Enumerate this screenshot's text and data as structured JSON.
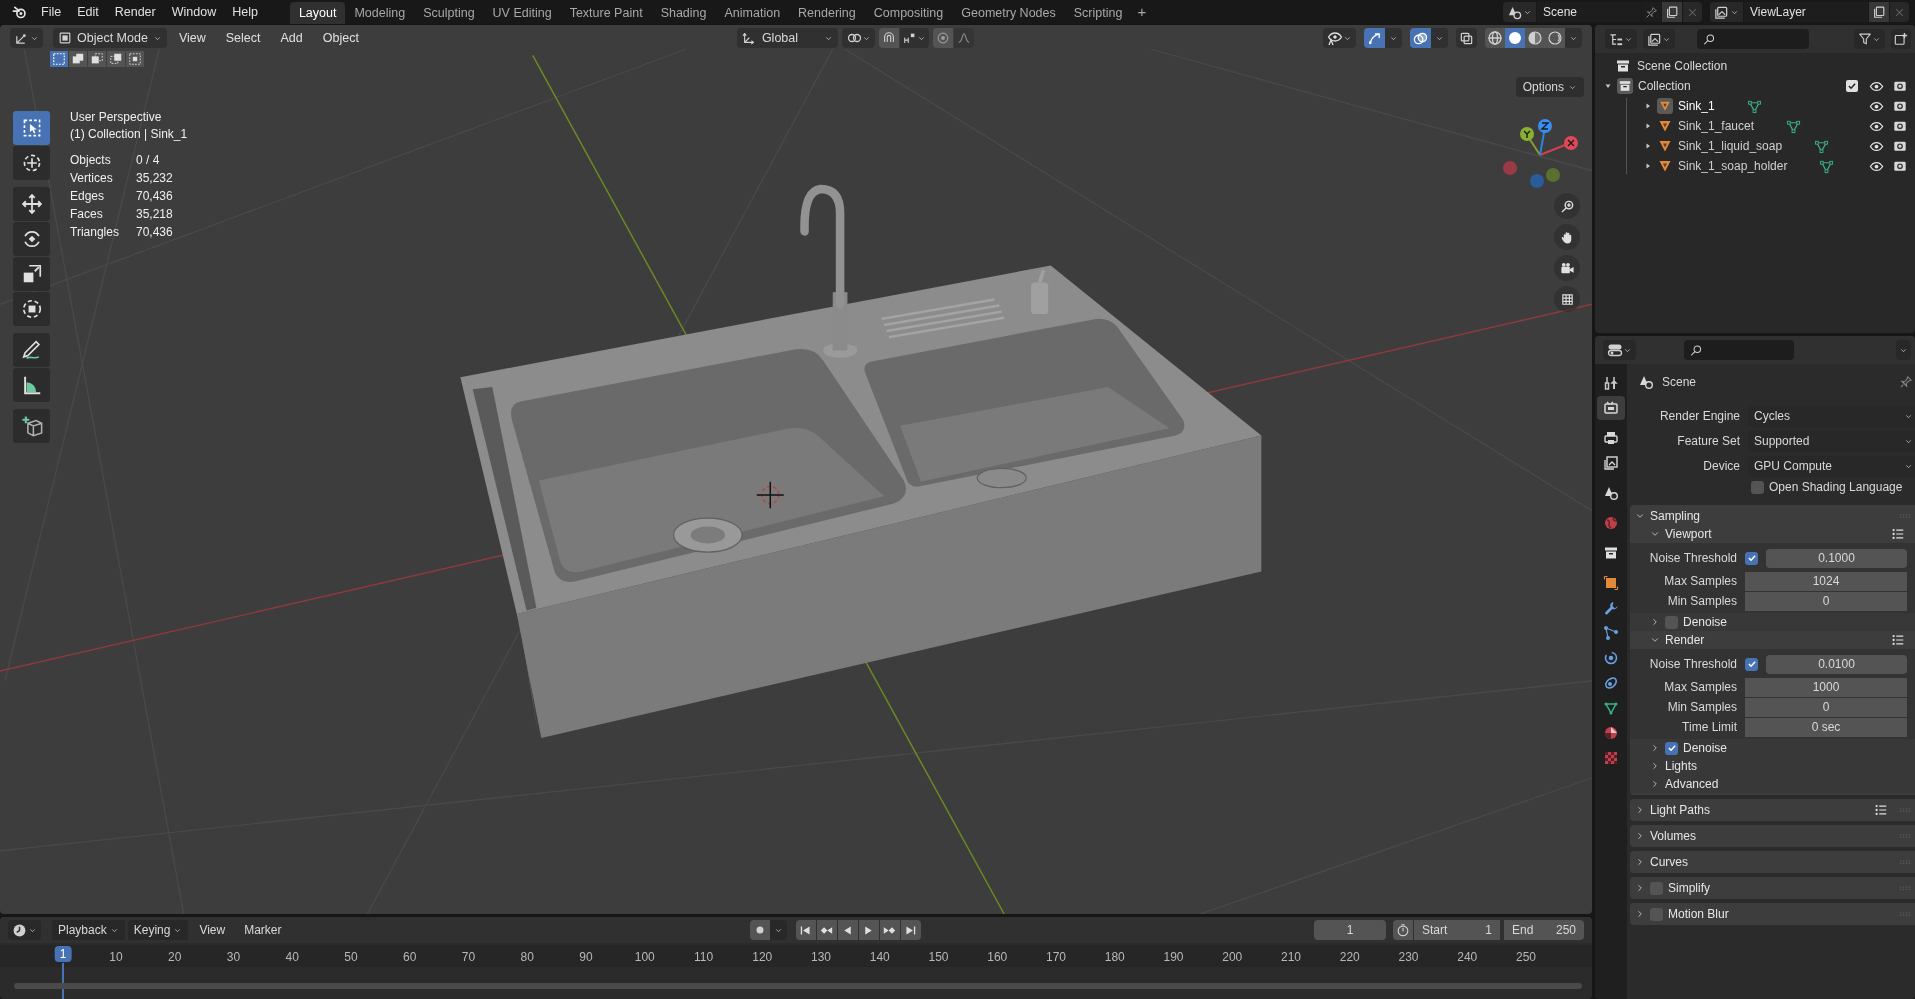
{
  "top_menu": [
    "File",
    "Edit",
    "Render",
    "Window",
    "Help"
  ],
  "workspaces": [
    {
      "label": "Layout",
      "selected": true
    },
    {
      "label": "Modeling",
      "selected": false
    },
    {
      "label": "Sculpting",
      "selected": false
    },
    {
      "label": "UV Editing",
      "selected": false
    },
    {
      "label": "Texture Paint",
      "selected": false
    },
    {
      "label": "Shading",
      "selected": false
    },
    {
      "label": "Animation",
      "selected": false
    },
    {
      "label": "Rendering",
      "selected": false
    },
    {
      "label": "Compositing",
      "selected": false
    },
    {
      "label": "Geometry Nodes",
      "selected": false
    },
    {
      "label": "Scripting",
      "selected": false
    }
  ],
  "add_workspace": "+",
  "scene": "Scene",
  "view_layer": "ViewLayer",
  "viewport": {
    "mode": "Object Mode",
    "menus": [
      "View",
      "Select",
      "Add",
      "Object"
    ],
    "select_modes": [
      {
        "kind": "set",
        "selected": true
      },
      {
        "kind": "extend",
        "selected": false
      },
      {
        "kind": "subtract",
        "selected": false
      },
      {
        "kind": "invert",
        "selected": false
      },
      {
        "kind": "intersect",
        "selected": false
      }
    ],
    "orientation": "Global",
    "gizmos_on": true,
    "overlays_on": true,
    "xray_on": false,
    "shading": [
      {
        "kind": "wireframe",
        "selected": false
      },
      {
        "kind": "solid",
        "selected": true
      },
      {
        "kind": "material",
        "selected": false
      },
      {
        "kind": "rendered",
        "selected": false
      }
    ],
    "options": "Options",
    "perspective": "User Perspective",
    "context": "(1) Collection | Sink_1",
    "stats": [
      {
        "label": "Objects",
        "value": "0 / 4"
      },
      {
        "label": "Vertices",
        "value": "35,232"
      },
      {
        "label": "Edges",
        "value": "70,436"
      },
      {
        "label": "Faces",
        "value": "35,218"
      },
      {
        "label": "Triangles",
        "value": "70,436"
      }
    ],
    "tools": [
      {
        "kind": "select",
        "selected": true
      },
      {
        "kind": "cursor",
        "selected": false
      },
      {
        "kind": "move",
        "selected": false
      },
      {
        "kind": "rotate",
        "selected": false
      },
      {
        "kind": "scale",
        "selected": false
      },
      {
        "kind": "transform",
        "selected": false
      },
      {
        "kind": "annotate",
        "selected": false
      },
      {
        "kind": "measure",
        "selected": false
      },
      {
        "kind": "add_cube",
        "selected": false
      }
    ]
  },
  "timeline": {
    "menus": [
      "Playback",
      "Keying",
      "View",
      "Marker"
    ],
    "current_frame": "1",
    "start_label": "Start",
    "start": "1",
    "end_label": "End",
    "end": "250",
    "cursor": "1",
    "ticks": [
      "10",
      "20",
      "30",
      "40",
      "50",
      "60",
      "70",
      "80",
      "90",
      "100",
      "110",
      "120",
      "130",
      "140",
      "150",
      "160",
      "170",
      "180",
      "190",
      "200",
      "210",
      "220",
      "230",
      "240",
      "250"
    ]
  },
  "outliner": {
    "root": "Scene Collection",
    "collections": [
      {
        "label": "Collection",
        "expanded": true,
        "checked": true,
        "children": [
          {
            "label": "Sink_1",
            "selected": true
          },
          {
            "label": "Sink_1_faucet",
            "selected": false
          },
          {
            "label": "Sink_1_liquid_soap",
            "selected": false
          },
          {
            "label": "Sink_1_soap_holder",
            "selected": false
          }
        ]
      }
    ]
  },
  "properties": {
    "context": "Scene",
    "tabs": [
      {
        "kind": "tool",
        "selected": false
      },
      {
        "kind": "render",
        "selected": true
      },
      {
        "kind": "output",
        "selected": false
      },
      {
        "kind": "view_layer",
        "selected": false
      },
      {
        "kind": "scene",
        "selected": false
      },
      {
        "kind": "world",
        "selected": false
      },
      {
        "kind": "collection",
        "selected": false
      },
      {
        "kind": "object",
        "selected": false
      },
      {
        "kind": "modifiers",
        "selected": false
      },
      {
        "kind": "particles",
        "selected": false
      },
      {
        "kind": "physics",
        "selected": false
      },
      {
        "kind": "constraints",
        "selected": false
      },
      {
        "kind": "data",
        "selected": false
      },
      {
        "kind": "material",
        "selected": false
      },
      {
        "kind": "texture",
        "selected": false
      }
    ],
    "fields": [
      {
        "label": "Render Engine",
        "value": "Cycles"
      },
      {
        "label": "Feature Set",
        "value": "Supported"
      },
      {
        "label": "Device",
        "value": "GPU Compute"
      }
    ],
    "osl": {
      "label": "Open Shading Language",
      "checked": false
    },
    "panels": [
      {
        "label": "Sampling",
        "expanded": true,
        "children": [
          {
            "label": "Viewport",
            "expanded": true,
            "presets": true,
            "rows": [
              {
                "kind": "toggle_number",
                "label": "Noise Threshold",
                "checked": true,
                "value": "0.1000"
              },
              {
                "kind": "number",
                "label": "Max Samples",
                "value": "1024"
              },
              {
                "kind": "number",
                "label": "Min Samples",
                "value": "0"
              }
            ]
          },
          {
            "label": "Denoise",
            "expanded": false,
            "checked": false
          },
          {
            "label": "Render",
            "expanded": true,
            "presets": true,
            "rows": [
              {
                "kind": "toggle_number",
                "label": "Noise Threshold",
                "checked": true,
                "value": "0.0100"
              },
              {
                "kind": "number",
                "label": "Max Samples",
                "value": "1000"
              },
              {
                "kind": "number",
                "label": "Min Samples",
                "value": "0"
              },
              {
                "kind": "number",
                "label": "Time Limit",
                "value": "0 sec"
              }
            ]
          },
          {
            "label": "Denoise",
            "expanded": false,
            "checked": true
          },
          {
            "label": "Lights",
            "expanded": false
          },
          {
            "label": "Advanced",
            "expanded": false
          }
        ]
      },
      {
        "label": "Light Paths",
        "expanded": false,
        "presets": true
      },
      {
        "label": "Volumes",
        "expanded": false
      },
      {
        "label": "Curves",
        "expanded": false
      },
      {
        "label": "Simplify",
        "expanded": false,
        "checked": false
      },
      {
        "label": "Motion Blur",
        "expanded": false,
        "checked": false
      }
    ]
  }
}
